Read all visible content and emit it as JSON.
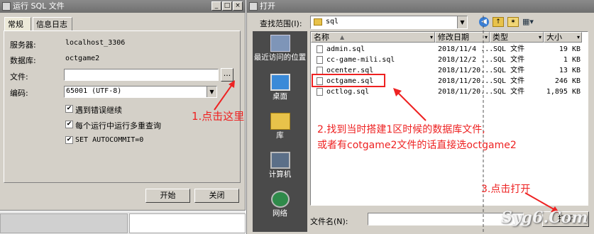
{
  "run_dialog": {
    "title": "运行 SQL 文件",
    "tabs": [
      "常规",
      "信息日志"
    ],
    "server_label": "服务器:",
    "server_value": "localhost_3306",
    "database_label": "数据库:",
    "database_value": "octgame2",
    "file_label": "文件:",
    "file_value": "",
    "browse_label": "...",
    "encoding_label": "编码:",
    "encoding_value": "65001 (UTF-8)",
    "options": [
      {
        "label": "遇到错误继续",
        "checked": true
      },
      {
        "label": "每个运行中运行多重查询",
        "checked": true
      },
      {
        "label": "SET AUTOCOMMIT=0",
        "checked": true
      }
    ],
    "start_label": "开始",
    "close_label": "关闭"
  },
  "open_dialog": {
    "title": "打开",
    "lookin_label": "查找范围(I):",
    "lookin_value": "sql",
    "places": [
      "最近访问的位置",
      "桌面",
      "库",
      "计算机",
      "网络"
    ],
    "columns": [
      "名称",
      "修改日期",
      "类型",
      "大小"
    ],
    "files": [
      {
        "name": "admin.sql",
        "date": "2018/11/4 ...",
        "type": "SQL 文件",
        "size": "19 KB"
      },
      {
        "name": "cc-game-mili.sql",
        "date": "2018/12/2 ...",
        "type": "SQL 文件",
        "size": "1 KB"
      },
      {
        "name": "ocenter.sql",
        "date": "2018/11/20...",
        "type": "SQL 文件",
        "size": "13 KB"
      },
      {
        "name": "octgame.sql",
        "date": "2018/11/20...",
        "type": "SQL 文件",
        "size": "246 KB"
      },
      {
        "name": "octlog.sql",
        "date": "2018/11/20...",
        "type": "SQL 文件",
        "size": "1,895 KB"
      }
    ],
    "filename_label": "文件名(N):",
    "filename_value": "",
    "open_label": "打开"
  },
  "annotations": {
    "step1": "1.点击这里",
    "step2_line1": "2.找到当时搭建1区时候的数据库文件,",
    "step2_line2": "或者有cotgame2文件的话直接选octgame2",
    "step3": "3.点击打开",
    "color": "#ee2222"
  },
  "watermark": "Syg6.Com"
}
